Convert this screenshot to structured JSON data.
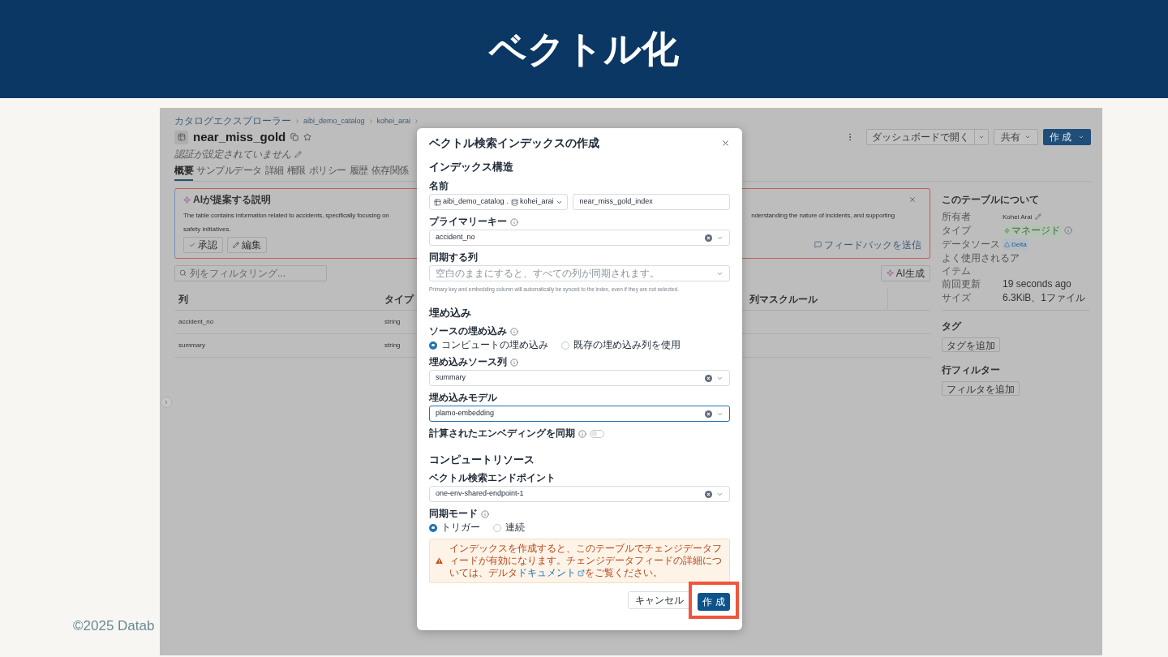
{
  "slide": {
    "title": "ベクトル化",
    "footer": "©2025 Datab"
  },
  "page": {
    "breadcrumb": [
      "カタログエクスプローラー",
      "aibi_demo_catalog",
      "kohei_arai"
    ],
    "title": "near_miss_gold",
    "subtitle": "認証が設定されていません",
    "tabs": [
      {
        "label": "概要",
        "selected": true
      },
      {
        "label": "サンプルデータ",
        "selected": false
      },
      {
        "label": "詳細",
        "selected": false
      },
      {
        "label": "権限",
        "selected": false
      },
      {
        "label": "ポリシー",
        "selected": false
      },
      {
        "label": "履歴",
        "selected": false
      },
      {
        "label": "依存関係",
        "selected": false
      }
    ],
    "header_buttons": {
      "open_dashboard": "ダッシュボードで開く",
      "share": "共有",
      "create": "作 成"
    },
    "ai_box": {
      "title": "AIが提案する説明",
      "text_left": "The table contains information related to accidents, specifically focusing on",
      "text_right": "nderstanding the nature of incidents, and supporting",
      "text_line2": "safety initiatives.",
      "approve": "承認",
      "edit": "編集",
      "feedback": "フィードバックを送信"
    },
    "filter": {
      "placeholder": "列をフィルタリング..."
    },
    "ai_generate": "AI生成",
    "table": {
      "columns": [
        "列",
        "タイプ",
        "列マスクルール"
      ],
      "rows": [
        [
          "accident_no",
          "string"
        ],
        [
          "summary",
          "string"
        ]
      ]
    },
    "about": {
      "title": "このテーブルについて",
      "fields": [
        {
          "kind": "editable",
          "label": "所有者",
          "value": "Kohei Arai"
        },
        {
          "kind": "managed",
          "label": "タイプ",
          "value": "マネージド"
        },
        {
          "kind": "delta",
          "label": "データソース",
          "value": "Delta"
        },
        {
          "kind": "usage",
          "label": "よく使用されるア",
          "label_cont": "イテム"
        },
        {
          "kind": "text",
          "label": "前回更新",
          "value": "19 seconds ago"
        },
        {
          "kind": "text",
          "label": "サイズ",
          "value": "6.3KiB、1ファイル"
        }
      ]
    },
    "tags": {
      "title": "タグ",
      "button": "タグを追加"
    },
    "row_filter": {
      "title": "行フィルター",
      "button": "フィルタを追加"
    }
  },
  "dialog": {
    "title": "ベクトル検索インデックスの作成",
    "index_structure": {
      "heading": "インデックス構造",
      "name_label": "名前",
      "catalog": "aibi_demo_catalog",
      "separator": ".",
      "schema": "kohei_arai",
      "index_name": "near_miss_gold_index",
      "primary_key_label": "プライマリーキー",
      "primary_key": "accident_no",
      "sync_columns_label": "同期する列",
      "sync_columns_placeholder": "空白のままにすると、すべての列が同期されます。",
      "sync_hint": "Primary key and embedding column will automatically be synced to the index, even if they are not selected."
    },
    "embedding": {
      "heading": "埋め込み",
      "source_label": "ソースの埋め込み",
      "source_options": [
        {
          "label": "コンピュートの埋め込み",
          "selected": true
        },
        {
          "label": "既存の埋め込み列を使用",
          "selected": false
        }
      ],
      "source_column_label": "埋め込みソース列",
      "source_column": "summary",
      "model_label": "埋め込みモデル",
      "model": "plamo-embedding",
      "model_focused": true,
      "sync_computed_label": "計算されたエンベディングを同期",
      "sync_computed_on": false
    },
    "compute": {
      "heading": "コンピュートリソース",
      "endpoint_label": "ベクトル検索エンドポイント",
      "endpoint": "one-env-shared-endpoint-1",
      "sync_mode_label": "同期モード",
      "sync_modes": [
        {
          "label": "トリガー",
          "selected": true
        },
        {
          "label": "連続",
          "selected": false
        }
      ]
    },
    "warning": {
      "text_before": "インデックスを作成すると、このテーブルでチェンジデータフィードが有効になります。チェンジデータフィードの詳細については、デルタ",
      "link": "ドキュメント",
      "text_after": "をご覧ください。"
    },
    "cancel": "キャンセル",
    "create": "作 成",
    "create_highlighted": true
  }
}
